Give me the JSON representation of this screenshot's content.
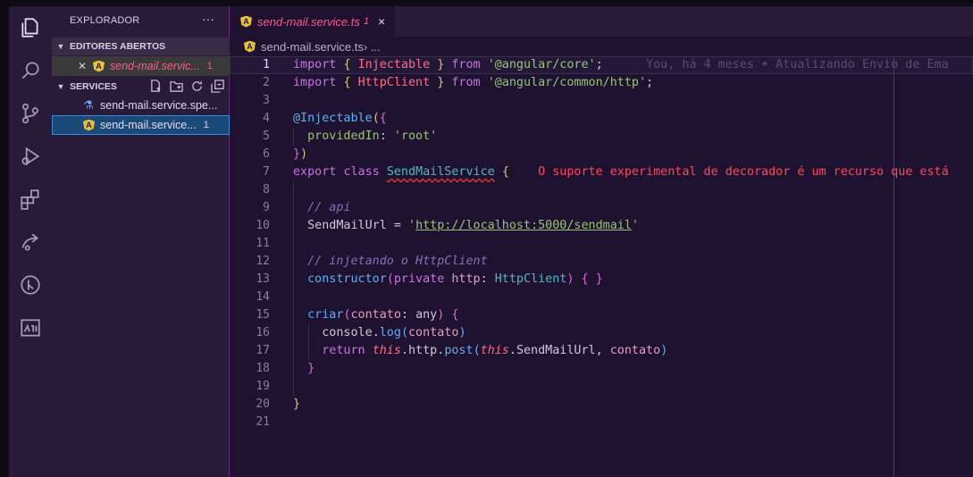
{
  "sidebar": {
    "title": "EXPLORADOR",
    "more": "···",
    "open_editors_label": "EDITORES ABERTOS",
    "services_label": "SERVICES",
    "open_file": {
      "name": "send-mail.servic...",
      "count": "1"
    },
    "files": [
      {
        "name": "send-mail.service.spe..."
      },
      {
        "name": "send-mail.service...",
        "count": "1"
      }
    ]
  },
  "tab": {
    "name": "send-mail.service.ts",
    "count": "1",
    "close": "×"
  },
  "breadcrumb": {
    "file": "send-mail.service.ts",
    "sep": " › ..."
  },
  "editor": {
    "line_numbers": [
      "1",
      "2",
      "3",
      "4",
      "5",
      "6",
      "7",
      "8",
      "9",
      "10",
      "11",
      "12",
      "13",
      "14",
      "15",
      "16",
      "17",
      "18",
      "19",
      "20",
      "21"
    ],
    "blame": "You, há 4 meses • Atualizando Envio de Ema",
    "diagnostic": "O suporte experimental de decorador é um recurso que está",
    "tokens": {
      "import": "import",
      "lbrace": "{",
      "rbrace": "}",
      "from": "from",
      "injectable": "Injectable",
      "httpclient": "HttpClient",
      "mod_core": "'@angular/core'",
      "mod_http": "'@angular/common/http'",
      "semi": ";",
      "decorator": "@Injectable",
      "lparen": "(",
      "rparen": ")",
      "provided_in": "providedIn",
      "colon": ":",
      "root": "'root'",
      "export": "export",
      "class": "class",
      "class_name": "SendMailService",
      "cmt_api": "// api",
      "send_mail_url": "SendMailUrl",
      "eq": "=",
      "q": "'",
      "url": "http://localhost:5000/sendmail",
      "cmt_inject": "// injetando o HttpClient",
      "constructor": "constructor",
      "private": "private",
      "http": "http",
      "criar": "criar",
      "contato": "contato",
      "any": "any",
      "console": "console",
      "dot": ".",
      "log": "log",
      "return": "return",
      "this": "this",
      "post": "post",
      "comma": ","
    }
  },
  "colors": {
    "accent": "#ff5a8a",
    "background": "#1f1130",
    "sidebar": "#2a1a3a",
    "selection": "#1a4a7a"
  }
}
